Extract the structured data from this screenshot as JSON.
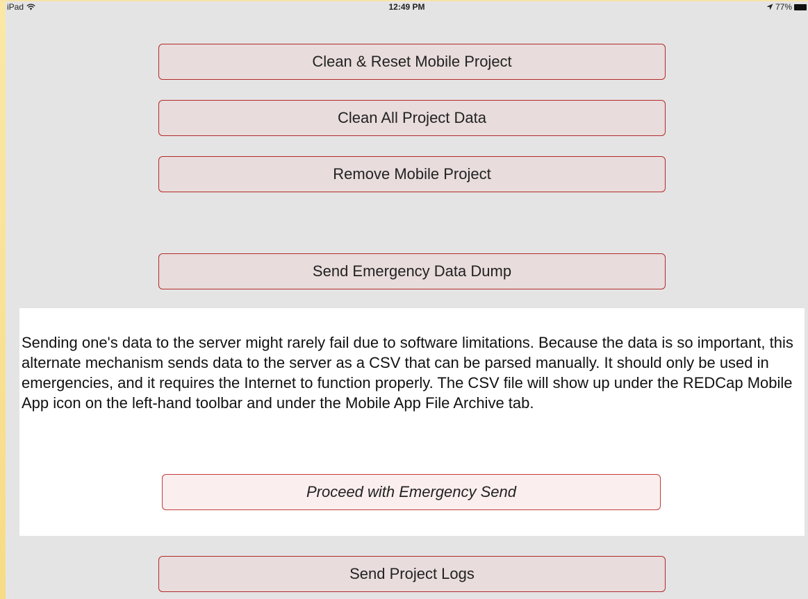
{
  "status_bar": {
    "device": "iPad",
    "time": "12:49 PM",
    "battery_percent": "77%"
  },
  "buttons": {
    "clean_reset": "Clean & Reset Mobile Project",
    "clean_all": "Clean All Project Data",
    "remove_project": "Remove Mobile Project",
    "emergency_dump": "Send Emergency Data Dump",
    "send_logs": "Send Project Logs"
  },
  "emergency_panel": {
    "description": "Sending one's data to the server might rarely fail due to software limitations. Because the data is so important, this alternate mechanism sends data to the server as a CSV that can be parsed manually. It should only be used in emergencies, and it requires the Internet to function properly. The CSV file will show up under the REDCap Mobile App icon on the left-hand toolbar and under the Mobile App File Archive tab.",
    "proceed_label": "Proceed with Emergency Send"
  },
  "colors": {
    "background": "#e5e4e5",
    "button_border": "#b22a2a",
    "button_fill": "#e8dcdc",
    "panel_fill": "#ffffff"
  }
}
